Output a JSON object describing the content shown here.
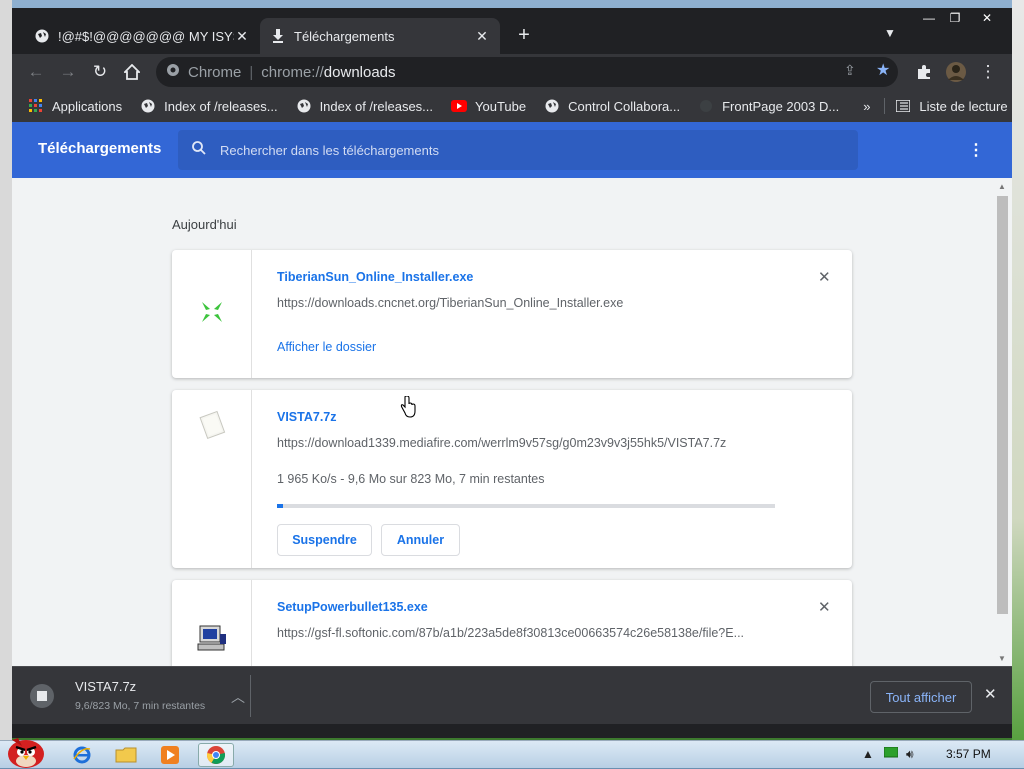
{
  "browser": {
    "tabs": [
      {
        "title": "!@#$!@@@@@@@ MY ISYS",
        "active": false,
        "icon": "globe-icon"
      },
      {
        "title": "Téléchargements",
        "active": true,
        "icon": "download-icon"
      }
    ],
    "omnibox": {
      "chip": "Chrome",
      "url_scheme": "chrome://",
      "url_path": "downloads"
    },
    "bookmarks": [
      {
        "label": "Applications",
        "icon": "apps-grid-icon"
      },
      {
        "label": "Index of /releases...",
        "icon": "globe-icon"
      },
      {
        "label": "Index of /releases...",
        "icon": "globe-icon"
      },
      {
        "label": "YouTube",
        "icon": "youtube-icon"
      },
      {
        "label": "Control Collabora...",
        "icon": "globe-icon"
      },
      {
        "label": "FrontPage 2003 D...",
        "icon": "blank-icon"
      }
    ],
    "reading_list": "Liste de lecture",
    "more_bookmarks": "»"
  },
  "page": {
    "title": "Téléchargements",
    "search_placeholder": "Rechercher dans les téléchargements",
    "section": "Aujourd'hui",
    "downloads": [
      {
        "name": "TiberianSun_Online_Installer.exe",
        "url": "https://downloads.cncnet.org/TiberianSun_Online_Installer.exe",
        "action": "Afficher le dossier"
      },
      {
        "name": "VISTA7.7z",
        "url": "https://download1339.mediafire.com/werrlm9v57sg/g0m23v9v3j55hk5/VISTA7.7z",
        "status": "1 965 Ko/s - 9,6 Mo sur 823 Mo, 7 min restantes",
        "progress": 0.012,
        "pause_label": "Suspendre",
        "cancel_label": "Annuler"
      },
      {
        "name": "SetupPowerbullet135.exe",
        "url": "https://gsf-fl.softonic.com/87b/a1b/223a5de8f30813ce00663574c26e58138e/file?E..."
      }
    ]
  },
  "shelf": {
    "item_name": "VISTA7.7z",
    "item_sub": "9,6/823 Mo, 7 min restantes",
    "show_all": "Tout afficher"
  },
  "taskbar": {
    "clock": "3:57 PM"
  },
  "colors": {
    "header_blue": "#3367d6",
    "link_blue": "#1a73e8",
    "chrome_dark": "#35363a"
  }
}
